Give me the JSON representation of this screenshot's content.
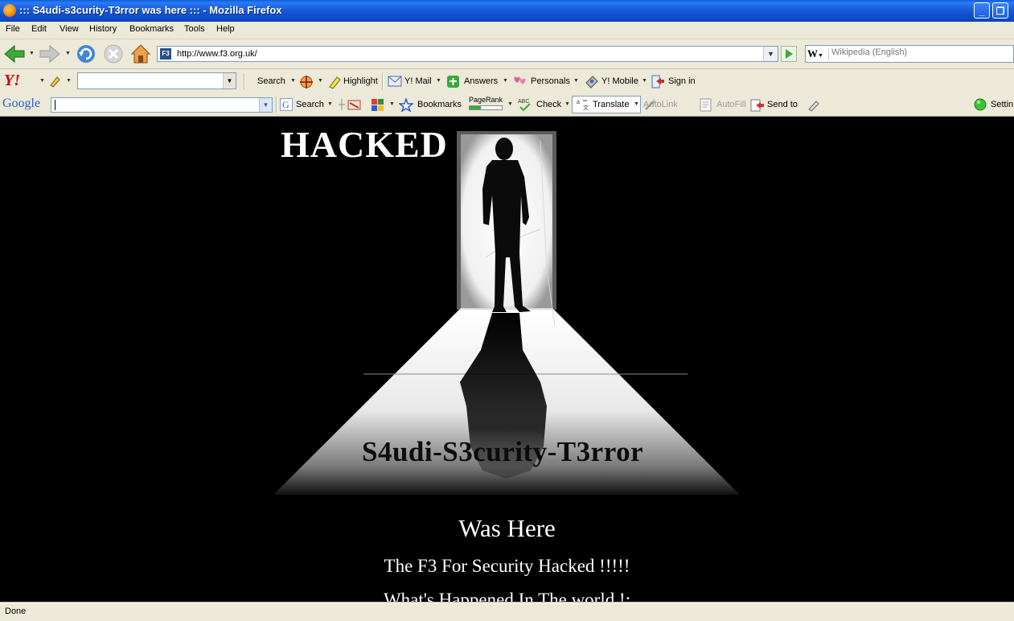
{
  "window": {
    "title": "::: S4udi-s3curity-T3rror was here ::: - Mozilla Firefox",
    "buttons": {
      "minimize": "_",
      "restore": "❐"
    }
  },
  "menu": [
    "File",
    "Edit",
    "View",
    "History",
    "Bookmarks",
    "Tools",
    "Help"
  ],
  "navbar": {
    "url": "http://www.f3.org.uk/",
    "favicon_text": "F3",
    "search_engine_icon": "W",
    "search_placeholder": "Wikipedia (English)"
  },
  "yahoo_toolbar": {
    "logo": "Y!",
    "items": [
      "Search",
      "Highlight",
      "Y! Mail",
      "Answers",
      "Personals",
      "Y! Mobile",
      "Sign in"
    ]
  },
  "google_toolbar": {
    "logo": "Google",
    "items": [
      "Search",
      "Bookmarks",
      "PageRank",
      "Check",
      "Translate",
      "AutoLink",
      "AutoFill",
      "Send to",
      "Settin"
    ]
  },
  "page": {
    "headline": "HACKED",
    "group_name": "S4udi-S3curity-T3rror",
    "was_here": "Was Here",
    "line1": "The F3 For Security Hacked !!!!!",
    "line2": "What's Happened In The world !:"
  },
  "status": "Done",
  "colors": {
    "titlebar": "#0a5fe0",
    "chrome": "#ece9d8",
    "page_background": "#000000",
    "page_text": "#ffffff"
  }
}
